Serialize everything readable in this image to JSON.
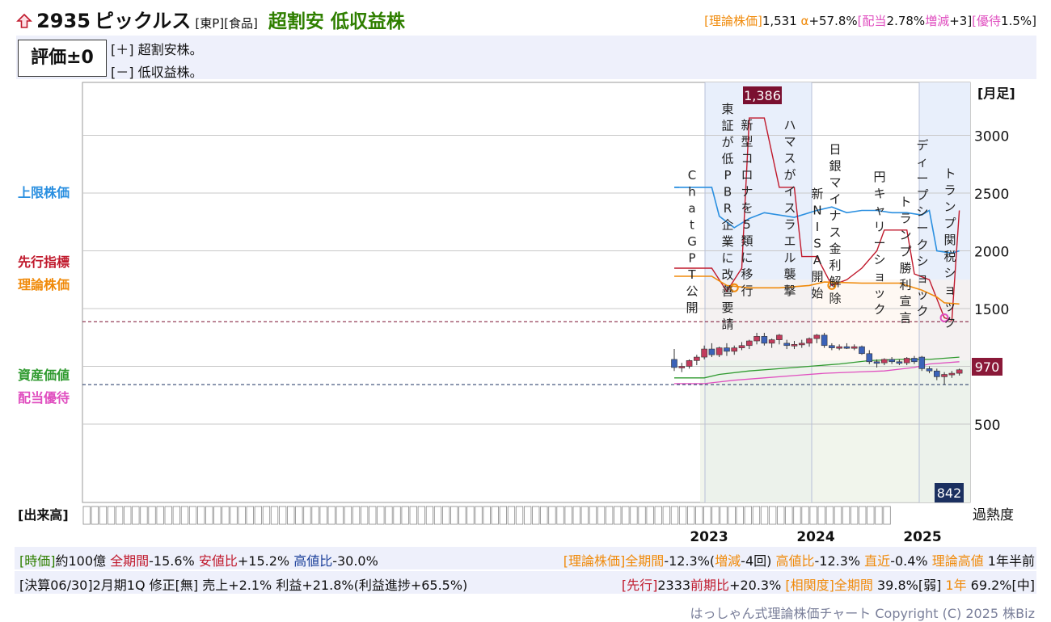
{
  "header": {
    "arrow_icon": "up-arrow-icon",
    "code": "2935",
    "name": "ピックルス",
    "market": "[東P][食品]",
    "badge": "超割安 低収益株",
    "summary": {
      "p1": "[理論株価]",
      "v1": "1,531",
      "p2": " α",
      "v2": "+57.8%",
      "p3": "[配当",
      "v3": "2.78%",
      "p4": "増減",
      "v4": "+3]",
      "p5": "[優待",
      "v5": "1.5%]"
    }
  },
  "evaluation": {
    "label": "評価±0",
    "plus": "[＋] 超割安株。",
    "minus": "[－] 低収益株。"
  },
  "side_labels": {
    "upper": "上限株価",
    "leading": "先行指標",
    "theory": "理論株価",
    "asset": "資産価値",
    "dividend": "配当優待"
  },
  "colors": {
    "upper": "#2a8fe0",
    "leading": "#c0192c",
    "theory": "#f08a0a",
    "asset": "#2f9a2f",
    "dividend": "#e050c0",
    "candle_up": "#c23b5c",
    "candle_down": "#3b62b8",
    "shade_blue": "#e8effb",
    "shade_green": "#e6f3e6"
  },
  "chart_data": {
    "type": "candlestick",
    "y_axis_label": "[月足]",
    "volume_label": "[出来高]",
    "overheat_label": "過熱度",
    "ylim": [
      0,
      3400
    ],
    "y_ticks": [
      500,
      1500,
      2000,
      2500,
      3000
    ],
    "year_labels": [
      "2023",
      "2024",
      "2025"
    ],
    "price_high_label": "1,386",
    "price_low_label": "842",
    "current_label": "970",
    "candles": [
      {
        "o": 1060,
        "h": 1150,
        "l": 960,
        "c": 990
      },
      {
        "o": 990,
        "h": 1030,
        "l": 950,
        "c": 1000
      },
      {
        "o": 1000,
        "h": 1060,
        "l": 980,
        "c": 1050
      },
      {
        "o": 1050,
        "h": 1100,
        "l": 1010,
        "c": 1080
      },
      {
        "o": 1080,
        "h": 1180,
        "l": 1060,
        "c": 1150
      },
      {
        "o": 1150,
        "h": 1200,
        "l": 1080,
        "c": 1100
      },
      {
        "o": 1100,
        "h": 1170,
        "l": 1080,
        "c": 1160
      },
      {
        "o": 1160,
        "h": 1200,
        "l": 1090,
        "c": 1130
      },
      {
        "o": 1130,
        "h": 1180,
        "l": 1100,
        "c": 1160
      },
      {
        "o": 1160,
        "h": 1210,
        "l": 1140,
        "c": 1180
      },
      {
        "o": 1180,
        "h": 1230,
        "l": 1150,
        "c": 1220
      },
      {
        "o": 1220,
        "h": 1290,
        "l": 1190,
        "c": 1260
      },
      {
        "o": 1260,
        "h": 1290,
        "l": 1180,
        "c": 1200
      },
      {
        "o": 1200,
        "h": 1240,
        "l": 1160,
        "c": 1230
      },
      {
        "o": 1230,
        "h": 1280,
        "l": 1190,
        "c": 1270
      },
      {
        "o": 1200,
        "h": 1230,
        "l": 1150,
        "c": 1180
      },
      {
        "o": 1180,
        "h": 1220,
        "l": 1150,
        "c": 1190
      },
      {
        "o": 1190,
        "h": 1230,
        "l": 1160,
        "c": 1200
      },
      {
        "o": 1200,
        "h": 1250,
        "l": 1170,
        "c": 1240
      },
      {
        "o": 1240,
        "h": 1280,
        "l": 1200,
        "c": 1270
      },
      {
        "o": 1270,
        "h": 1290,
        "l": 1160,
        "c": 1180
      },
      {
        "o": 1180,
        "h": 1200,
        "l": 1140,
        "c": 1160
      },
      {
        "o": 1160,
        "h": 1190,
        "l": 1140,
        "c": 1170
      },
      {
        "o": 1170,
        "h": 1200,
        "l": 1150,
        "c": 1160
      },
      {
        "o": 1160,
        "h": 1190,
        "l": 1140,
        "c": 1170
      },
      {
        "o": 1170,
        "h": 1180,
        "l": 1100,
        "c": 1110
      },
      {
        "o": 1110,
        "h": 1140,
        "l": 1020,
        "c": 1040
      },
      {
        "o": 1040,
        "h": 1060,
        "l": 990,
        "c": 1030
      },
      {
        "o": 1030,
        "h": 1070,
        "l": 1010,
        "c": 1060
      },
      {
        "o": 1060,
        "h": 1080,
        "l": 1020,
        "c": 1040
      },
      {
        "o": 1040,
        "h": 1060,
        "l": 1010,
        "c": 1030
      },
      {
        "o": 1030,
        "h": 1080,
        "l": 1010,
        "c": 1070
      },
      {
        "o": 1070,
        "h": 1090,
        "l": 1020,
        "c": 1040
      },
      {
        "o": 1080,
        "h": 1090,
        "l": 960,
        "c": 980
      },
      {
        "o": 980,
        "h": 1000,
        "l": 940,
        "c": 960
      },
      {
        "o": 960,
        "h": 980,
        "l": 880,
        "c": 910
      },
      {
        "o": 910,
        "h": 950,
        "l": 842,
        "c": 930
      },
      {
        "o": 930,
        "h": 960,
        "l": 900,
        "c": 940
      },
      {
        "o": 940,
        "h": 980,
        "l": 920,
        "c": 970
      }
    ],
    "upper_line": [
      [
        0,
        2550
      ],
      [
        5,
        2550
      ],
      [
        6,
        2300
      ],
      [
        8,
        2200
      ],
      [
        10,
        2280
      ],
      [
        12,
        2330
      ],
      [
        16,
        2290
      ],
      [
        19,
        2350
      ],
      [
        21,
        2380
      ],
      [
        23,
        2330
      ],
      [
        25,
        2350
      ],
      [
        27,
        2350
      ],
      [
        29,
        2330
      ],
      [
        31,
        2330
      ],
      [
        33,
        2310
      ],
      [
        34,
        2350
      ],
      [
        35,
        2000
      ],
      [
        37,
        1980
      ],
      [
        38,
        2000
      ]
    ],
    "leading_line": [
      [
        0,
        1850
      ],
      [
        5,
        1850
      ],
      [
        7,
        1650
      ],
      [
        9,
        1850
      ],
      [
        10,
        3150
      ],
      [
        12,
        3150
      ],
      [
        14,
        2550
      ],
      [
        16,
        2550
      ],
      [
        17,
        1950
      ],
      [
        19,
        1950
      ],
      [
        21,
        1700
      ],
      [
        23,
        1750
      ],
      [
        25,
        1850
      ],
      [
        27,
        2000
      ],
      [
        28,
        2180
      ],
      [
        31,
        2180
      ],
      [
        32,
        1800
      ],
      [
        34,
        1750
      ],
      [
        36,
        1420
      ],
      [
        37,
        1400
      ],
      [
        38,
        2350
      ]
    ],
    "theory_line": [
      [
        0,
        1780
      ],
      [
        5,
        1780
      ],
      [
        7,
        1700
      ],
      [
        10,
        1680
      ],
      [
        14,
        1680
      ],
      [
        18,
        1700
      ],
      [
        20,
        1730
      ],
      [
        25,
        1720
      ],
      [
        30,
        1720
      ],
      [
        33,
        1660
      ],
      [
        35,
        1600
      ],
      [
        36,
        1550
      ],
      [
        38,
        1540
      ]
    ],
    "asset_line": [
      [
        0,
        900
      ],
      [
        4,
        900
      ],
      [
        6,
        930
      ],
      [
        10,
        960
      ],
      [
        14,
        980
      ],
      [
        18,
        1000
      ],
      [
        22,
        1020
      ],
      [
        26,
        1050
      ],
      [
        30,
        1060
      ],
      [
        34,
        1060
      ],
      [
        38,
        1080
      ]
    ],
    "dividend_line": [
      [
        0,
        850
      ],
      [
        4,
        850
      ],
      [
        8,
        880
      ],
      [
        12,
        900
      ],
      [
        16,
        920
      ],
      [
        20,
        940
      ],
      [
        24,
        950
      ],
      [
        28,
        960
      ],
      [
        32,
        990
      ],
      [
        34,
        1020
      ],
      [
        38,
        1040
      ]
    ],
    "events": [
      {
        "i": 2,
        "text": "ChatGPT公開"
      },
      {
        "i": 4,
        "text": "東証が低PBR企業に改善要請"
      },
      {
        "i": 6,
        "text": "新型コロナを5類に移行"
      },
      {
        "i": 10,
        "text": "ハマスがイスラエル襲撃"
      },
      {
        "i": 13,
        "text": "新NISA開始"
      },
      {
        "i": 15,
        "text": "日銀マイナス金利解除"
      },
      {
        "i": 20,
        "text": "円キャリーショック"
      },
      {
        "i": 22,
        "text": "トランプ勝利宣言"
      },
      {
        "i": 25,
        "text": "ディープシークショック"
      },
      {
        "i": 28,
        "text": "トランプ関税ショック"
      }
    ]
  },
  "footer": {
    "line1_left": [
      {
        "t": "[時価]",
        "c": "#2f7f00"
      },
      {
        "t": "約100億 ",
        "c": "#111"
      },
      {
        "t": "全期間",
        "c": "#c0192c"
      },
      {
        "t": "-15.6% ",
        "c": "#111"
      },
      {
        "t": "安値比",
        "c": "#c0192c"
      },
      {
        "t": "+15.2% ",
        "c": "#111"
      },
      {
        "t": "高値比",
        "c": "#1b3f9a"
      },
      {
        "t": "-30.0%",
        "c": "#111"
      }
    ],
    "line1_right": [
      {
        "t": "[理論株価]",
        "c": "#f08a0a"
      },
      {
        "t": "全期間",
        "c": "#f08a0a"
      },
      {
        "t": "-12.3%(",
        "c": "#111"
      },
      {
        "t": "増減",
        "c": "#f08a0a"
      },
      {
        "t": "-4回) ",
        "c": "#111"
      },
      {
        "t": "高値比",
        "c": "#f08a0a"
      },
      {
        "t": "-12.3% ",
        "c": "#111"
      },
      {
        "t": "直近",
        "c": "#f08a0a"
      },
      {
        "t": "-0.4% ",
        "c": "#111"
      },
      {
        "t": "理論高値",
        "c": "#f08a0a"
      },
      {
        "t": " 1年半前",
        "c": "#111"
      }
    ],
    "line2_left": "[決算06/30]2月期1Q 修正[無] 売上+2.1% 利益+21.8%(利益進捗+65.5%)",
    "line2_right": [
      {
        "t": "[先行]",
        "c": "#c0192c"
      },
      {
        "t": "2333",
        "c": "#111"
      },
      {
        "t": "前期比",
        "c": "#c0192c"
      },
      {
        "t": "+20.3% ",
        "c": "#111"
      },
      {
        "t": "[相関度]",
        "c": "#f08a0a"
      },
      {
        "t": "全期間",
        "c": "#f08a0a"
      },
      {
        "t": " 39.8%[弱] ",
        "c": "#111"
      },
      {
        "t": "1年",
        "c": "#f08a0a"
      },
      {
        "t": " 69.2%[中]",
        "c": "#111"
      }
    ],
    "copyright": "はっしゃん式理論株価チャート Copyright (C) 2025 株Biz"
  }
}
